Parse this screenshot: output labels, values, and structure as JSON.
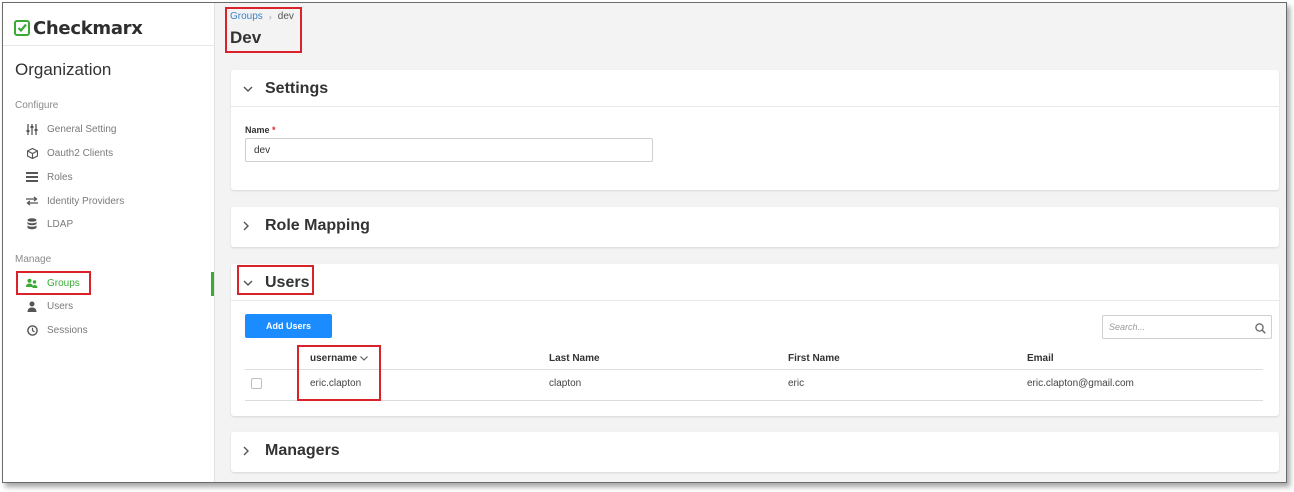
{
  "sidebar": {
    "logo": "Checkmarx",
    "org_title": "Organization",
    "configure_label": "Configure",
    "manage_label": "Manage",
    "configure_items": [
      {
        "label": "General Setting",
        "icon": "sliders-icon"
      },
      {
        "label": "Oauth2 Clients",
        "icon": "cube-icon"
      },
      {
        "label": "Roles",
        "icon": "list-icon"
      },
      {
        "label": "Identity Providers",
        "icon": "exchange-icon"
      },
      {
        "label": "LDAP",
        "icon": "database-icon"
      }
    ],
    "manage_items": [
      {
        "label": "Groups",
        "icon": "users-icon",
        "active": true
      },
      {
        "label": "Users",
        "icon": "user-icon"
      },
      {
        "label": "Sessions",
        "icon": "clock-icon"
      }
    ]
  },
  "breadcrumb": {
    "parent": "Groups",
    "separator": "›",
    "current": "dev"
  },
  "page_title": "Dev",
  "settings": {
    "title": "Settings",
    "name_label": "Name",
    "required_mark": "*",
    "name_value": "dev"
  },
  "role_mapping": {
    "title": "Role Mapping"
  },
  "users": {
    "title": "Users",
    "add_button": "Add Users",
    "search_placeholder": "Search...",
    "columns": [
      "username",
      "Last Name",
      "First Name",
      "Email"
    ],
    "rows": [
      {
        "username": "eric.clapton",
        "last_name": "clapton",
        "first_name": "eric",
        "email": "eric.clapton@gmail.com"
      }
    ]
  },
  "managers": {
    "title": "Managers"
  },
  "colors": {
    "brand_green": "#3aaa35",
    "primary_blue": "#1a8cff",
    "highlight_red": "#d9222a",
    "link_blue": "#3b82c4"
  }
}
